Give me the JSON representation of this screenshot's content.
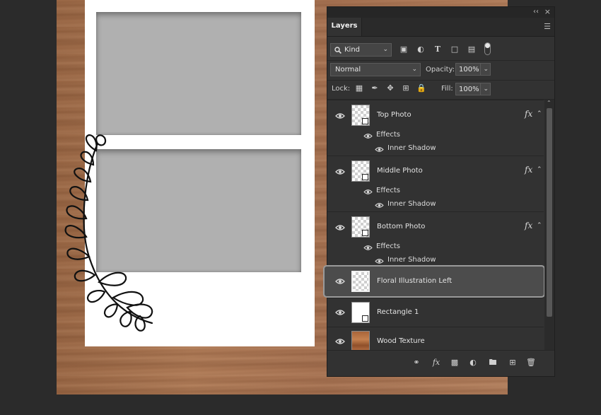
{
  "panel": {
    "collapse_glyph": "‹‹",
    "close_glyph": "×",
    "tab_label": "Layers",
    "menu_icon": "hamburger-icon",
    "filter": {
      "label": "Kind",
      "icons": [
        "image-filter-icon",
        "adjustment-filter-icon",
        "type-filter-icon",
        "shape-filter-icon",
        "smart-object-filter-icon"
      ]
    },
    "blend_mode": "Normal",
    "opacity_label": "Opacity:",
    "opacity_value": "100%",
    "lock_label": "Lock:",
    "lock_icons": [
      "lock-transparent-icon",
      "lock-paint-icon",
      "lock-position-icon",
      "lock-artboard-icon",
      "lock-all-icon"
    ],
    "fill_label": "Fill:",
    "fill_value": "100%"
  },
  "layers": [
    {
      "name": "Top Photo",
      "fx": "fx",
      "effects_label": "Effects",
      "effect": "Inner Shadow"
    },
    {
      "name": "Middle Photo",
      "fx": "fx",
      "effects_label": "Effects",
      "effect": "Inner Shadow"
    },
    {
      "name": "Bottom Photo",
      "fx": "fx",
      "effects_label": "Effects",
      "effect": "Inner Shadow"
    },
    {
      "name": "Floral Illustration Left",
      "selected": true
    },
    {
      "name": "Rectangle 1"
    },
    {
      "name": "Wood Texture"
    }
  ],
  "bottom_tools": [
    "link-layers-icon",
    "fx-icon",
    "add-mask-icon",
    "adjustment-layer-icon",
    "new-group-icon",
    "new-layer-icon",
    "delete-icon"
  ],
  "bottom_fx_label": "fx",
  "colors": {
    "panel_bg": "#323232",
    "selected_bg": "#4c4c4c",
    "canvas_bg": "#2b2b2b",
    "photo_placeholder": "#b0b0b0"
  }
}
